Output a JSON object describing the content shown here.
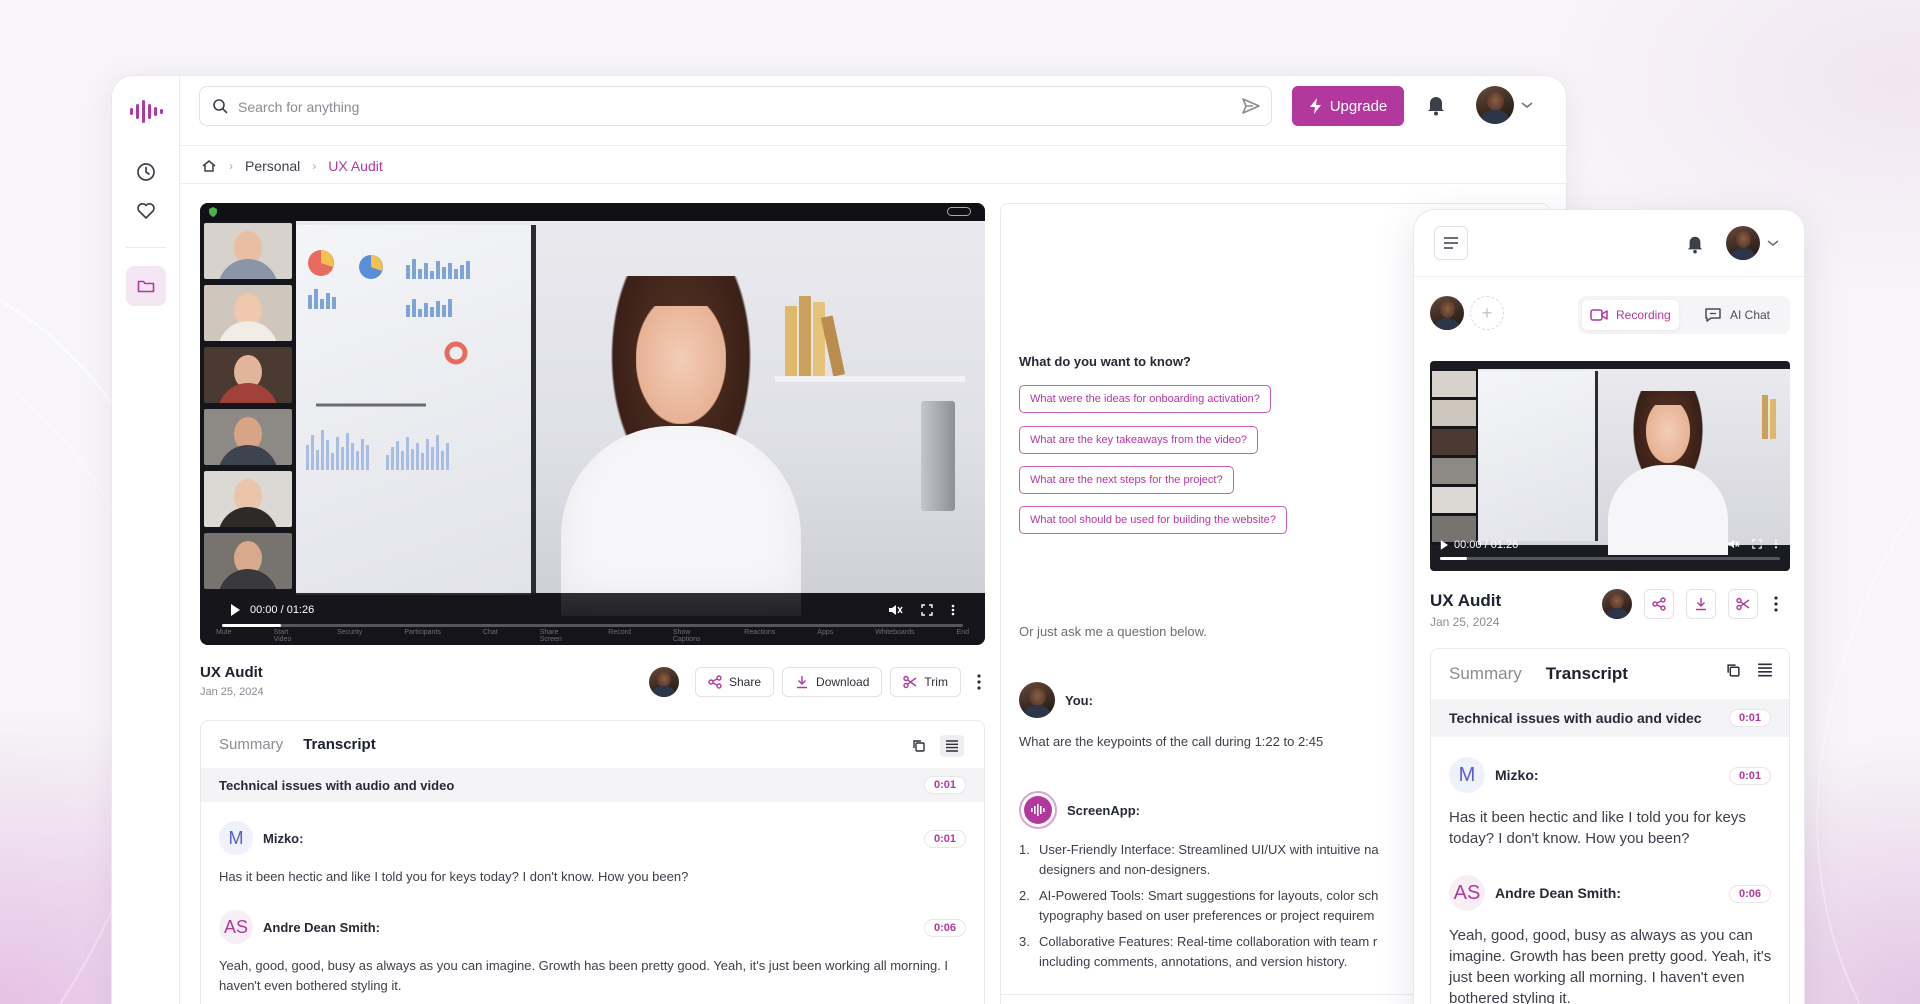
{
  "search": {
    "placeholder": "Search for anything"
  },
  "topbar": {
    "upgrade_label": "Upgrade"
  },
  "breadcrumb": {
    "level1": "Personal",
    "level2": "UX Audit"
  },
  "video": {
    "time": "00:00 / 01:26",
    "progress": 0.08,
    "toolbar": [
      "Mute",
      "Start Video",
      "Security",
      "Participants",
      "Chat",
      "Share Screen",
      "Record",
      "Show Captions",
      "Reactions",
      "Apps",
      "Whiteboards",
      "End"
    ]
  },
  "meeting": {
    "title": "UX Audit",
    "date": "Jan 25, 2024"
  },
  "actions": {
    "share": "Share",
    "download": "Download",
    "trim": "Trim"
  },
  "transcript": {
    "tab_summary": "Summary",
    "tab_transcript": "Transcript",
    "chapter": "Technical issues with audio and video",
    "chapter_time": "0:01",
    "entries": [
      {
        "initials": "M",
        "speaker": "Mizko:",
        "time": "0:01",
        "text": "Has it been hectic and like I told you for keys today? I don't know. How you been?"
      },
      {
        "initials": "AS",
        "speaker": "Andre Dean Smith:",
        "time": "0:06",
        "text": "Yeah, good, good, busy as always as you can imagine. Growth has been pretty good. Yeah, it's just been working all morning. I haven't even bothered styling it."
      }
    ]
  },
  "chat": {
    "prompt_title": "What do you want to know?",
    "suggestions": [
      "What were the ideas for onboarding activation?",
      "What are the key takeaways from the video?",
      "What are the next steps for the project?",
      "What tool should be used for building the website?"
    ],
    "or_ask": "Or just ask me a question below.",
    "user_label": "You:",
    "user_question": "What are the keypoints of the call during 1:22 to 2:45",
    "bot_label": "ScreenApp:",
    "answer": [
      {
        "n": "1.",
        "line1": "User-Friendly Interface: Streamlined UI/UX with intuitive na",
        "line2": "designers and non-designers."
      },
      {
        "n": "2.",
        "line1": "AI-Powered Tools: Smart suggestions for layouts, color sch",
        "line2": "typography based on user preferences or project requirem"
      },
      {
        "n": "3.",
        "line1": "Collaborative Features: Real-time collaboration with team r",
        "line2": "including comments, annotations, and version history."
      }
    ],
    "input_placeholder": "What do you want to know?"
  },
  "mobile": {
    "tab_recording": "Recording",
    "tab_ai_chat": "AI Chat",
    "time": "00:00 / 01:26",
    "title": "UX Audit",
    "date": "Jan 25, 2024",
    "tab_summary": "Summary",
    "tab_transcript": "Transcript",
    "chapter": "Technical issues with audio and videc",
    "chapter_time": "0:01",
    "entries": [
      {
        "initials": "M",
        "speaker": "Mizko:",
        "time": "0:01",
        "text": "Has it been hectic and like I told you for keys today? I don't know. How you been?"
      },
      {
        "initials": "AS",
        "speaker": "Andre Dean Smith:",
        "time": "0:06",
        "text": "Yeah, good, good, busy as always as you can imagine. Growth has been pretty good. Yeah, it's just been working all morning. I haven't even bothered styling it."
      }
    ]
  },
  "colors": {
    "accent": "#b3389e",
    "accent_light": "#f5e6f4"
  }
}
